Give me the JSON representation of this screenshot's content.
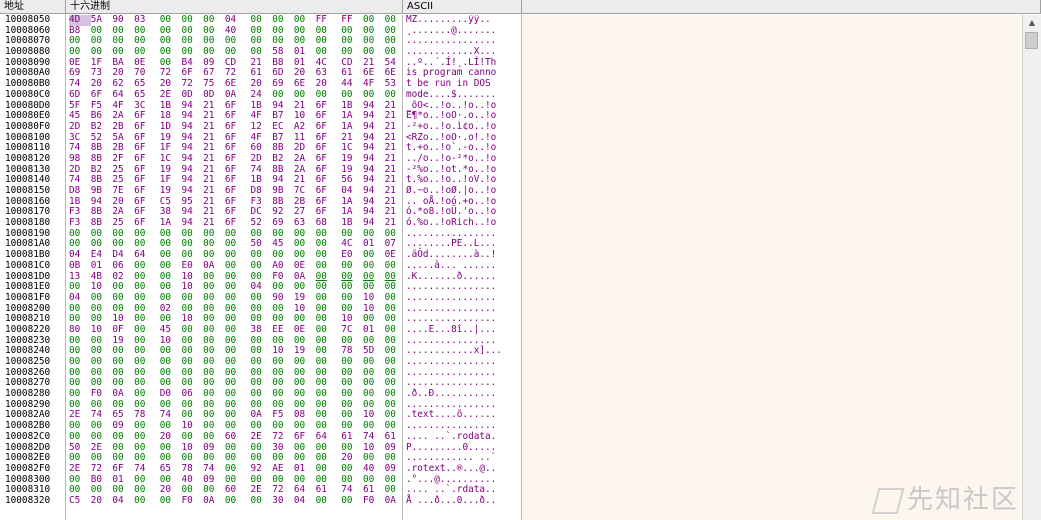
{
  "headers": {
    "address": "地址",
    "hex": "十六进制",
    "ascii": "ASCII"
  },
  "rows": [
    {
      "addr": "10008050",
      "hex": [
        "4D",
        "5A",
        "90",
        "03",
        "00",
        "00",
        "00",
        "04",
        "00",
        "00",
        "00",
        "FF",
        "FF",
        "00",
        "00"
      ],
      "ascii": "MZ.........ÿÿ.."
    },
    {
      "addr": "10008060",
      "hex": [
        "B8",
        "00",
        "00",
        "00",
        "00",
        "00",
        "00",
        "40",
        "00",
        "00",
        "00",
        "00",
        "00",
        "00",
        "00"
      ],
      "ascii": "¸.......@......."
    },
    {
      "addr": "10008070",
      "hex": [
        "00",
        "00",
        "00",
        "00",
        "00",
        "00",
        "00",
        "00",
        "00",
        "00",
        "00",
        "00",
        "00",
        "00",
        "00"
      ],
      "ascii": "................"
    },
    {
      "addr": "10008080",
      "hex": [
        "00",
        "00",
        "00",
        "00",
        "00",
        "00",
        "00",
        "00",
        "00",
        "58",
        "01",
        "00",
        "00",
        "00",
        "00"
      ],
      "ascii": "............X..."
    },
    {
      "addr": "10008090",
      "hex": [
        "0E",
        "1F",
        "BA",
        "0E",
        "00",
        "B4",
        "09",
        "CD",
        "21",
        "B8",
        "01",
        "4C",
        "CD",
        "21",
        "54",
        "68"
      ],
      "ascii": "..º..´.Í!¸.LÍ!Th"
    },
    {
      "addr": "100080A0",
      "hex": [
        "69",
        "73",
        "20",
        "70",
        "72",
        "6F",
        "67",
        "72",
        "61",
        "6D",
        "20",
        "63",
        "61",
        "6E",
        "6E",
        "6F"
      ],
      "ascii": "is program canno"
    },
    {
      "addr": "100080B0",
      "hex": [
        "74",
        "20",
        "62",
        "65",
        "20",
        "72",
        "75",
        "6E",
        "20",
        "69",
        "6E",
        "20",
        "44",
        "4F",
        "53",
        "20"
      ],
      "ascii": "t be run in DOS "
    },
    {
      "addr": "100080C0",
      "hex": [
        "6D",
        "6F",
        "64",
        "65",
        "2E",
        "0D",
        "0D",
        "0A",
        "24",
        "00",
        "00",
        "00",
        "00",
        "00",
        "00",
        "00"
      ],
      "ascii": "mode....$......."
    },
    {
      "addr": "100080D0",
      "hex": [
        "5F",
        "F5",
        "4F",
        "3C",
        "1B",
        "94",
        "21",
        "6F",
        "1B",
        "94",
        "21",
        "6F",
        "1B",
        "94",
        "21",
        "6F"
      ],
      "ascii": "_õO<..!o..!o..!o"
    },
    {
      "addr": "100080E0",
      "hex": [
        "45",
        "B6",
        "2A",
        "6F",
        "18",
        "94",
        "21",
        "6F",
        "4F",
        "B7",
        "10",
        "6F",
        "1A",
        "94",
        "21",
        "6F"
      ],
      "ascii": "E¶*o..!oO·.o..!o"
    },
    {
      "addr": "100080F0",
      "hex": [
        "2D",
        "B2",
        "2B",
        "6F",
        "1D",
        "94",
        "21",
        "6F",
        "12",
        "EC",
        "A2",
        "6F",
        "1A",
        "94",
        "21",
        "6F"
      ],
      "ascii": "-²+o..!o.ì¢o..!o"
    },
    {
      "addr": "10008100",
      "hex": [
        "3C",
        "52",
        "5A",
        "6F",
        "19",
        "94",
        "21",
        "6F",
        "4F",
        "B7",
        "11",
        "6F",
        "21",
        "94",
        "21",
        "6F"
      ],
      "ascii": "<RZo..!oO·.o!.!o"
    },
    {
      "addr": "10008110",
      "hex": [
        "74",
        "8B",
        "2B",
        "6F",
        "1F",
        "94",
        "21",
        "6F",
        "60",
        "8B",
        "2D",
        "6F",
        "1C",
        "94",
        "21",
        "6F"
      ],
      "ascii": "t.+o..!o`.-o..!o"
    },
    {
      "addr": "10008120",
      "hex": [
        "98",
        "8B",
        "2F",
        "6F",
        "1C",
        "94",
        "21",
        "6F",
        "2D",
        "B2",
        "2A",
        "6F",
        "19",
        "94",
        "21",
        "6F"
      ],
      "ascii": "../o..!o-²*o..!o"
    },
    {
      "addr": "10008130",
      "hex": [
        "2D",
        "B2",
        "25",
        "6F",
        "19",
        "94",
        "21",
        "6F",
        "74",
        "8B",
        "2A",
        "6F",
        "19",
        "94",
        "21",
        "6F"
      ],
      "ascii": "-²%o..!ot.*o..!o"
    },
    {
      "addr": "10008140",
      "hex": [
        "74",
        "8B",
        "25",
        "6F",
        "1F",
        "94",
        "21",
        "6F",
        "1B",
        "94",
        "21",
        "6F",
        "56",
        "94",
        "21",
        "6F"
      ],
      "ascii": "t.%o..!o..!oV.!o"
    },
    {
      "addr": "10008150",
      "hex": [
        "D8",
        "9B",
        "7E",
        "6F",
        "19",
        "94",
        "21",
        "6F",
        "D8",
        "9B",
        "7C",
        "6F",
        "04",
        "94",
        "21",
        "6F"
      ],
      "ascii": "Ø.~o..!oØ.|o..!o"
    },
    {
      "addr": "10008160",
      "hex": [
        "1B",
        "94",
        "20",
        "6F",
        "C5",
        "95",
        "21",
        "6F",
        "F3",
        "8B",
        "2B",
        "6F",
        "1A",
        "94",
        "21",
        "6F"
      ],
      "ascii": ".. oÅ.!oó.+o..!o"
    },
    {
      "addr": "10008170",
      "hex": [
        "F3",
        "8B",
        "2A",
        "6F",
        "38",
        "94",
        "21",
        "6F",
        "DC",
        "92",
        "27",
        "6F",
        "1A",
        "94",
        "21",
        "6F"
      ],
      "ascii": "ó.*o8.!oÜ.'o..!o"
    },
    {
      "addr": "10008180",
      "hex": [
        "F3",
        "8B",
        "25",
        "6F",
        "1A",
        "94",
        "21",
        "6F",
        "52",
        "69",
        "63",
        "68",
        "1B",
        "94",
        "21",
        "6F"
      ],
      "ascii": "ó.%o..!oRich..!o"
    },
    {
      "addr": "10008190",
      "hex": [
        "00",
        "00",
        "00",
        "00",
        "00",
        "00",
        "00",
        "00",
        "00",
        "00",
        "00",
        "00",
        "00",
        "00",
        "00",
        "00"
      ],
      "ascii": "................"
    },
    {
      "addr": "100081A0",
      "hex": [
        "00",
        "00",
        "00",
        "00",
        "00",
        "00",
        "00",
        "00",
        "50",
        "45",
        "00",
        "00",
        "4C",
        "01",
        "07",
        "00"
      ],
      "ascii": "........PE..L..."
    },
    {
      "addr": "100081B0",
      "hex": [
        "04",
        "E4",
        "D4",
        "64",
        "00",
        "00",
        "00",
        "00",
        "00",
        "00",
        "00",
        "00",
        "E0",
        "00",
        "0E",
        "21"
      ],
      "ascii": ".äÔd........à..!"
    },
    {
      "addr": "100081C0",
      "hex": [
        "0B",
        "01",
        "06",
        "00",
        "00",
        "E0",
        "0A",
        "00",
        "00",
        "A0",
        "0E",
        "00",
        "00",
        "00",
        "00",
        "00"
      ],
      "ascii": ".....à... ......"
    },
    {
      "addr": "100081D0",
      "hex": [
        "13",
        "4B",
        "02",
        "00",
        "00",
        "10",
        "00",
        "00",
        "00",
        "F0",
        "0A",
        "00",
        "00",
        "00",
        "00",
        "10"
      ],
      "ascii": ".K.......ð......"
    },
    {
      "addr": "100081E0",
      "hex": [
        "00",
        "10",
        "00",
        "00",
        "00",
        "10",
        "00",
        "00",
        "04",
        "00",
        "00",
        "00",
        "00",
        "00",
        "00",
        "00"
      ],
      "ascii": "................"
    },
    {
      "addr": "100081F0",
      "hex": [
        "04",
        "00",
        "00",
        "00",
        "00",
        "00",
        "00",
        "00",
        "00",
        "90",
        "19",
        "00",
        "00",
        "10",
        "00",
        "00"
      ],
      "ascii": "................"
    },
    {
      "addr": "10008200",
      "hex": [
        "00",
        "00",
        "00",
        "00",
        "02",
        "00",
        "00",
        "00",
        "00",
        "00",
        "10",
        "00",
        "00",
        "10",
        "00",
        "00"
      ],
      "ascii": "................"
    },
    {
      "addr": "10008210",
      "hex": [
        "00",
        "00",
        "10",
        "00",
        "00",
        "10",
        "00",
        "00",
        "00",
        "00",
        "00",
        "00",
        "10",
        "00",
        "00",
        "00"
      ],
      "ascii": "................"
    },
    {
      "addr": "10008220",
      "hex": [
        "80",
        "10",
        "0F",
        "00",
        "45",
        "00",
        "00",
        "00",
        "38",
        "EE",
        "0E",
        "00",
        "7C",
        "01",
        "00",
        "00"
      ],
      "ascii": "....E...8î..|..."
    },
    {
      "addr": "10008230",
      "hex": [
        "00",
        "00",
        "19",
        "00",
        "10",
        "00",
        "00",
        "00",
        "00",
        "00",
        "00",
        "00",
        "00",
        "00",
        "00",
        "00"
      ],
      "ascii": "................"
    },
    {
      "addr": "10008240",
      "hex": [
        "00",
        "00",
        "00",
        "00",
        "00",
        "00",
        "00",
        "00",
        "00",
        "10",
        "19",
        "00",
        "78",
        "5D",
        "00",
        "00"
      ],
      "ascii": "............x]..."
    },
    {
      "addr": "10008250",
      "hex": [
        "00",
        "00",
        "00",
        "00",
        "00",
        "00",
        "00",
        "00",
        "00",
        "00",
        "00",
        "00",
        "00",
        "00",
        "00",
        "00"
      ],
      "ascii": "................"
    },
    {
      "addr": "10008260",
      "hex": [
        "00",
        "00",
        "00",
        "00",
        "00",
        "00",
        "00",
        "00",
        "00",
        "00",
        "00",
        "00",
        "00",
        "00",
        "00",
        "00"
      ],
      "ascii": "................"
    },
    {
      "addr": "10008270",
      "hex": [
        "00",
        "00",
        "00",
        "00",
        "00",
        "00",
        "00",
        "00",
        "00",
        "00",
        "00",
        "00",
        "00",
        "00",
        "00",
        "00"
      ],
      "ascii": "................"
    },
    {
      "addr": "10008280",
      "hex": [
        "00",
        "F0",
        "0A",
        "00",
        "D0",
        "06",
        "00",
        "00",
        "00",
        "00",
        "00",
        "00",
        "00",
        "00",
        "00",
        "00"
      ],
      "ascii": ".ð..Ð..........."
    },
    {
      "addr": "10008290",
      "hex": [
        "00",
        "00",
        "00",
        "00",
        "00",
        "00",
        "00",
        "00",
        "00",
        "00",
        "00",
        "00",
        "00",
        "00",
        "00",
        "00"
      ],
      "ascii": "................"
    },
    {
      "addr": "100082A0",
      "hex": [
        "2E",
        "74",
        "65",
        "78",
        "74",
        "00",
        "00",
        "00",
        "0A",
        "F5",
        "08",
        "00",
        "00",
        "10",
        "00",
        "00"
      ],
      "ascii": ".text....õ......"
    },
    {
      "addr": "100082B0",
      "hex": [
        "00",
        "00",
        "09",
        "00",
        "00",
        "10",
        "00",
        "00",
        "00",
        "00",
        "00",
        "00",
        "00",
        "00",
        "00",
        "00"
      ],
      "ascii": "................"
    },
    {
      "addr": "100082C0",
      "hex": [
        "00",
        "00",
        "00",
        "00",
        "20",
        "00",
        "00",
        "60",
        "2E",
        "72",
        "6F",
        "64",
        "61",
        "74",
        "61",
        "00"
      ],
      "ascii": ".... ..`.rodata."
    },
    {
      "addr": "100082D0",
      "hex": [
        "50",
        "2E",
        "00",
        "00",
        "00",
        "10",
        "09",
        "00",
        "00",
        "30",
        "00",
        "00",
        "00",
        "10",
        "09",
        "00"
      ],
      "ascii": "P.........0....."
    },
    {
      "addr": "100082E0",
      "hex": [
        "00",
        "00",
        "00",
        "00",
        "00",
        "00",
        "00",
        "00",
        "00",
        "00",
        "00",
        "00",
        "20",
        "00",
        "00",
        "60"
      ],
      "ascii": "............ ..`"
    },
    {
      "addr": "100082F0",
      "hex": [
        "2E",
        "72",
        "6F",
        "74",
        "65",
        "78",
        "74",
        "00",
        "92",
        "AE",
        "01",
        "00",
        "00",
        "40",
        "09",
        "00"
      ],
      "ascii": ".rotext..®...@.."
    },
    {
      "addr": "10008300",
      "hex": [
        "00",
        "B0",
        "01",
        "00",
        "00",
        "40",
        "09",
        "00",
        "00",
        "00",
        "00",
        "00",
        "00",
        "00",
        "00",
        "00"
      ],
      "ascii": ".°...@.........."
    },
    {
      "addr": "10008310",
      "hex": [
        "00",
        "00",
        "00",
        "00",
        "20",
        "00",
        "00",
        "60",
        "2E",
        "72",
        "64",
        "61",
        "74",
        "61",
        "00",
        "00"
      ],
      "ascii": ".... ..`.rdata.."
    },
    {
      "addr": "10008320",
      "hex": [
        "C5",
        "20",
        "04",
        "00",
        "00",
        "F0",
        "0A",
        "00",
        "00",
        "30",
        "04",
        "00",
        "00",
        "F0",
        "0A",
        "00"
      ],
      "ascii": "Å ...ð...0...ð.."
    }
  ],
  "watermark": "先知社区",
  "colors": {
    "zero": "#008000",
    "nonzero": "#800080",
    "selection": "#d8c0e0"
  }
}
